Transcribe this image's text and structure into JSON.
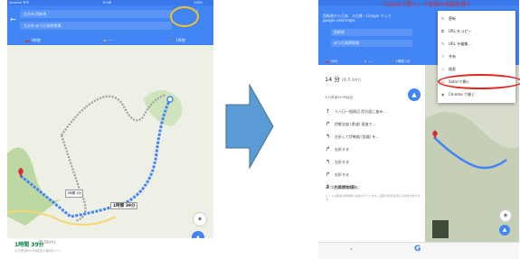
{
  "left_screen": {
    "status": {
      "carrier": "docomo 令令",
      "time": "19:08",
      "battery": "100%"
    },
    "origin_field": "大分市 西新地",
    "destination_field": "大分市 みつだ高原牧場",
    "modes": [
      "🚗 3時間",
      "🚆 —",
      "🚶 1時間"
    ],
    "map_label": "1時間 39分",
    "map_small_label": "1時間 4分",
    "duration": "1時間 39分",
    "distance": "(6.5km)",
    "description": "大分県道540号経由の最適ルート",
    "route_color": "#4285f4"
  },
  "right_screen": {
    "header_note": "「Safariで開く」で普段の地図を開く",
    "url_line1": "西新地から日本、大分県 › Google マップ",
    "url_line2": "google.com/maps",
    "origin_field": "西新地",
    "destination_field": "みつだ高原牧場",
    "modes": [
      "🚗 56分",
      "🚆 —",
      "🚶 1時間 4分"
    ],
    "summary_time": "14 分",
    "summary_dist": "(6.5 km)",
    "summary_desc": "大分県道540号経由",
    "steps": [
      {
        "icon": "↑",
        "text": "十八日一組周辺 西方面に進み..."
      },
      {
        "icon": "↱",
        "text": "伊都全般 (県道) 直進で..."
      },
      {
        "icon": "↰",
        "text": "左折して伊勢路 (国道) を..."
      },
      {
        "icon": "↱",
        "text": "右折する"
      },
      {
        "icon": "↰",
        "text": "左折する"
      },
      {
        "icon": "↱",
        "text": "右折する"
      },
      {
        "icon": "↑",
        "text": "目的地は右側に"
      }
    ],
    "section_title": "みつだ高原牧場",
    "paragraph": "ルートの情報は参考用に提供されています。実際の状況は変わる場合があります。",
    "menu": [
      {
        "icon": "↻",
        "label": "更新"
      },
      {
        "icon": "⧉",
        "label": "URL をコピー"
      },
      {
        "icon": "✎",
        "label": "URL を編集..."
      },
      {
        "icon": "⇪",
        "label": "共有"
      },
      {
        "icon": "☆",
        "label": "検索"
      },
      {
        "icon": "◎",
        "label": "Safariで開く"
      },
      {
        "icon": "◉",
        "label": "Chrome で開く"
      }
    ],
    "google_mark": "G",
    "highlight_color": "#e0261f"
  }
}
